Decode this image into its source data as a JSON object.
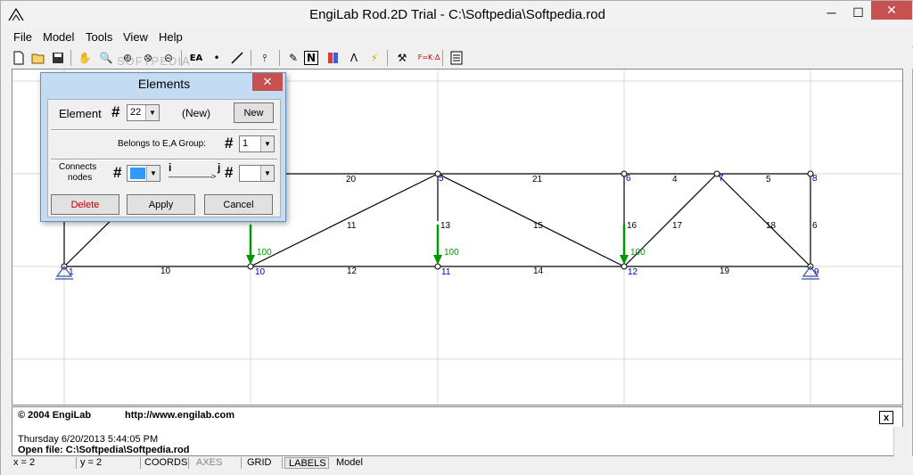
{
  "window": {
    "title": "EngiLab Rod.2D Trial - C:\\Softpedia\\Softpedia.rod",
    "minimize": "─",
    "maximize": "☐",
    "close": "✕"
  },
  "menu": [
    "File",
    "Model",
    "Tools",
    "View",
    "Help"
  ],
  "toolbar": {
    "watermark": "SOFTPEDIA",
    "buttons": [
      "new-file-icon",
      "open-folder-icon",
      "save-icon",
      "pan-hand-icon",
      "zoom-window-icon",
      "zoom-in-icon",
      "zoom-extents-icon",
      "zoom-out-icon",
      "ea-group-icon",
      "node-icon",
      "element-line-icon",
      "support-icon",
      "pencil-icon",
      "numbering-icon",
      "material-icon",
      "triangle-icon",
      "load-bolt-icon",
      "tools-icon",
      "fka-icon",
      "report-icon"
    ],
    "ea_label": "EA",
    "fka_label": "F=K·Δ",
    "numbering_label": "N"
  },
  "dialog": {
    "title": "Elements",
    "close": "✕",
    "element_label": "Element",
    "hash": "#",
    "element_value": "22",
    "new_state": "(New)",
    "new_button": "New",
    "group_label": "Belongs to E,A Group:",
    "group_value": "1",
    "connects_label_1": "Connects",
    "connects_label_2": "nodes",
    "i_label": "i",
    "j_label": "j",
    "arrow": "——————>",
    "delete_button": "Delete",
    "apply_button": "Apply",
    "cancel_button": "Cancel"
  },
  "model": {
    "node_labels": [
      "1",
      "10",
      "11",
      "12",
      "9",
      "5",
      "6",
      "7",
      "8"
    ],
    "element_labels": [
      "10",
      "12",
      "14",
      "19",
      "20",
      "21",
      "4",
      "5",
      "11",
      "13",
      "15",
      "16",
      "17",
      "18",
      "6"
    ],
    "load_value": "100",
    "colors": {
      "member": "#000000",
      "node_label": "#0000c0",
      "element_label": "#000000",
      "load": "#009900",
      "grid": "#d8d8d8"
    }
  },
  "log": {
    "line1_copy": "© 2004 EngiLab",
    "line1_url": "http://www.engilab.com",
    "line2": "Thursday 6/20/2013 5:44:05 PM",
    "line3": "Open file: C:\\Softpedia\\Softpedia.rod",
    "close": "x"
  },
  "status": {
    "x": "x = 2",
    "y": "y = 2",
    "coords": "COORDS",
    "axes": "AXES",
    "grid": "GRID",
    "labels": "LABELS",
    "mode": "Model"
  }
}
